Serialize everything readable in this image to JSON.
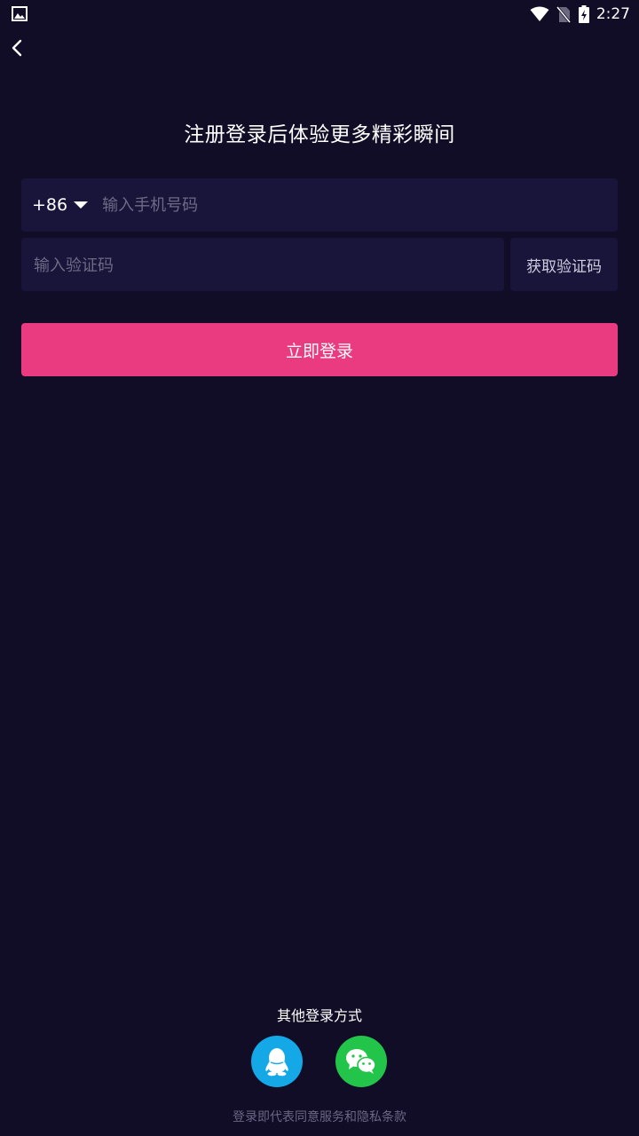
{
  "status_bar": {
    "time": "2:27",
    "icons": [
      "image-icon",
      "wifi-icon",
      "no-sim-icon",
      "battery-charging-icon"
    ]
  },
  "nav": {
    "back_icon": "chevron-left-icon"
  },
  "title": "注册登录后体验更多精彩瞬间",
  "phone": {
    "country_code": "+86",
    "placeholder": "输入手机号码",
    "value": ""
  },
  "code": {
    "placeholder": "输入验证码",
    "value": "",
    "get_code_label": "获取验证码"
  },
  "login_button": "立即登录",
  "other_login": {
    "label": "其他登录方式",
    "methods": [
      {
        "icon": "qq-icon",
        "color": "#14a8e6"
      },
      {
        "icon": "wechat-icon",
        "color": "#22c44a"
      }
    ]
  },
  "terms": "登录即代表同意服务和隐私条款",
  "colors": {
    "background": "#110d27",
    "input_bg": "#18143a",
    "accent": "#ea3a80",
    "placeholder": "#6e6a86"
  }
}
